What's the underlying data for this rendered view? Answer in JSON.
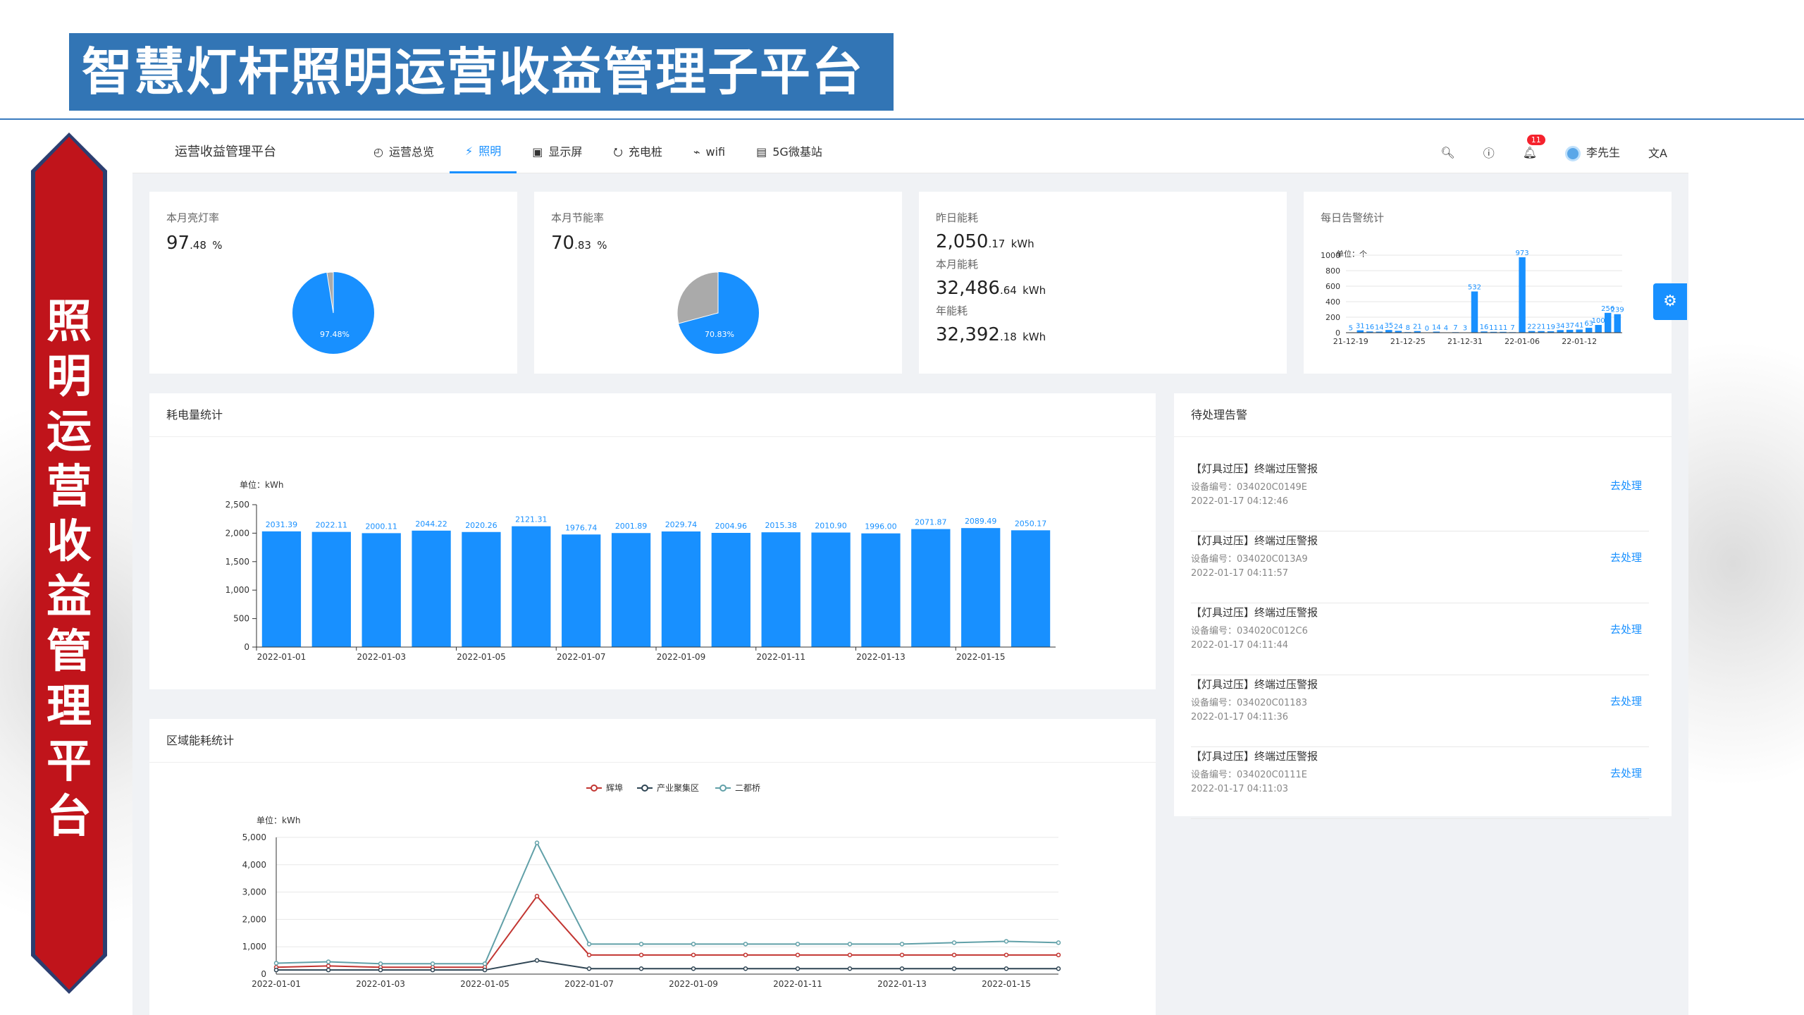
{
  "slide": {
    "title": "智慧灯杆照明运营收益管理子平台",
    "banner_chars": [
      "照",
      "明",
      "运",
      "营",
      "收",
      "益",
      "管",
      "理",
      "平",
      "台"
    ]
  },
  "app": {
    "brand": "运营收益管理平台",
    "nav": [
      {
        "label": "运营总览",
        "icon": "clock-icon"
      },
      {
        "label": "照明",
        "icon": "lightning-icon",
        "active": true
      },
      {
        "label": "显示屏",
        "icon": "screen-icon"
      },
      {
        "label": "充电桩",
        "icon": "charger-icon"
      },
      {
        "label": "wifi",
        "icon": "wifi-icon"
      },
      {
        "label": "5G微基站",
        "icon": "station-icon"
      }
    ],
    "notification_count": "11",
    "user": "李先生",
    "accent": "#1890ff"
  },
  "kpi": {
    "light_rate": {
      "label": "本月亮灯率",
      "int": "97",
      "dec": ".48",
      "unit": "%",
      "pie_label": "97.48%",
      "value": 0.9748
    },
    "save_rate": {
      "label": "本月节能率",
      "int": "70",
      "dec": ".83",
      "unit": "%",
      "pie_label": "70.83%",
      "value": 0.7083
    },
    "energy": {
      "yesterday_label": "昨日能耗",
      "yesterday_int": "2,050",
      "yesterday_dec": ".17",
      "unit": "kWh",
      "month_label": "本月能耗",
      "month_int": "32,486",
      "month_dec": ".64",
      "year_label": "年能耗",
      "year_int": "32,392",
      "year_dec": ".18"
    },
    "alarm_label": "每日告警统计"
  },
  "panels": {
    "power_title": "耗电量统计",
    "region_title": "区域能耗统计",
    "alarm_title": "待处理告警"
  },
  "alarms": [
    {
      "title": "【灯具过压】终端过压警报",
      "device": "设备编号：034020C0149E",
      "time": "2022-01-17 04:12:46",
      "action": "去处理"
    },
    {
      "title": "【灯具过压】终端过压警报",
      "device": "设备编号：034020C013A9",
      "time": "2022-01-17 04:11:57",
      "action": "去处理"
    },
    {
      "title": "【灯具过压】终端过压警报",
      "device": "设备编号：034020C012C6",
      "time": "2022-01-17 04:11:44",
      "action": "去处理"
    },
    {
      "title": "【灯具过压】终端过压警报",
      "device": "设备编号：034020C01183",
      "time": "2022-01-17 04:11:36",
      "action": "去处理"
    },
    {
      "title": "【灯具过压】终端过压警报",
      "device": "设备编号：034020C0111E",
      "time": "2022-01-17 04:11:03",
      "action": "去处理"
    }
  ],
  "chart_data": [
    {
      "id": "daily_alarm",
      "type": "bar",
      "unit_label": "单位：个",
      "ylim": [
        0,
        1000
      ],
      "y_ticks": [
        0,
        200,
        400,
        600,
        800,
        1000
      ],
      "x_tick_labels": [
        "21-12-19",
        "21-12-25",
        "21-12-31",
        "22-01-06",
        "22-01-12"
      ],
      "values": [
        5,
        31,
        16,
        14,
        35,
        24,
        8,
        21,
        0,
        14,
        4,
        7,
        3,
        532,
        16,
        11,
        11,
        7,
        973,
        22,
        21,
        19,
        34,
        37,
        41,
        63,
        100,
        256,
        239
      ],
      "labels": [
        "5",
        "31",
        "16",
        "14",
        "35",
        "24",
        "8",
        "21",
        "0",
        "14",
        "4",
        "7",
        "3",
        "532",
        "16",
        "11",
        "11",
        "7",
        "973",
        "22",
        "21",
        "19",
        "34",
        "37",
        "41",
        "63",
        "100",
        "256",
        "239"
      ]
    },
    {
      "id": "power",
      "type": "bar",
      "unit_label": "单位：kWh",
      "ylim": [
        0,
        2500
      ],
      "y_ticks": [
        0,
        500,
        1000,
        1500,
        2000,
        2500
      ],
      "y_tick_labels": [
        "0",
        "500",
        "1,000",
        "1,500",
        "2,000",
        "2,500"
      ],
      "categories": [
        "2022-01-01",
        "2022-01-02",
        "2022-01-03",
        "2022-01-04",
        "2022-01-05",
        "2022-01-06",
        "2022-01-07",
        "2022-01-08",
        "2022-01-09",
        "2022-01-10",
        "2022-01-11",
        "2022-01-12",
        "2022-01-13",
        "2022-01-14",
        "2022-01-15",
        "2022-01-16"
      ],
      "x_tick_labels": [
        "2022-01-01",
        "2022-01-03",
        "2022-01-05",
        "2022-01-07",
        "2022-01-09",
        "2022-01-11",
        "2022-01-13",
        "2022-01-15"
      ],
      "values": [
        2031.39,
        2022.11,
        2000.11,
        2044.22,
        2020.26,
        2121.31,
        1976.74,
        2001.89,
        2029.74,
        2004.96,
        2015.38,
        2010.9,
        1996.0,
        2071.87,
        2089.49,
        2050.17
      ],
      "labels": [
        "2031.39",
        "2022.11",
        "2000.11",
        "2044.22",
        "2020.26",
        "2121.31",
        "1976.74",
        "2001.89",
        "2029.74",
        "2004.96",
        "2015.38",
        "2010.90",
        "1996.00",
        "2071.87",
        "2089.49",
        "2050.17"
      ],
      "color": "#1890ff"
    },
    {
      "id": "region",
      "type": "line",
      "unit_label": "单位：kWh",
      "ylim": [
        0,
        5000
      ],
      "y_ticks": [
        0,
        1000,
        2000,
        3000,
        4000,
        5000
      ],
      "y_tick_labels": [
        "0",
        "1,000",
        "2,000",
        "3,000",
        "4,000",
        "5,000"
      ],
      "x_tick_labels": [
        "2022-01-01",
        "2022-01-03",
        "2022-01-05",
        "2022-01-07",
        "2022-01-09",
        "2022-01-11",
        "2022-01-13",
        "2022-01-15"
      ],
      "series": [
        {
          "name": "辉埠",
          "color": "#c23531",
          "values": [
            250,
            300,
            250,
            250,
            250,
            2850,
            700,
            700,
            700,
            700,
            700,
            700,
            700,
            700,
            700,
            700
          ]
        },
        {
          "name": "产业聚集区",
          "color": "#2f4554",
          "values": [
            150,
            150,
            150,
            150,
            150,
            500,
            200,
            200,
            200,
            200,
            200,
            200,
            200,
            200,
            200,
            200
          ]
        },
        {
          "name": "二都桥",
          "color": "#61a0a8",
          "values": [
            400,
            450,
            380,
            380,
            380,
            4800,
            1100,
            1100,
            1100,
            1100,
            1100,
            1100,
            1100,
            1150,
            1200,
            1150
          ]
        }
      ]
    }
  ]
}
